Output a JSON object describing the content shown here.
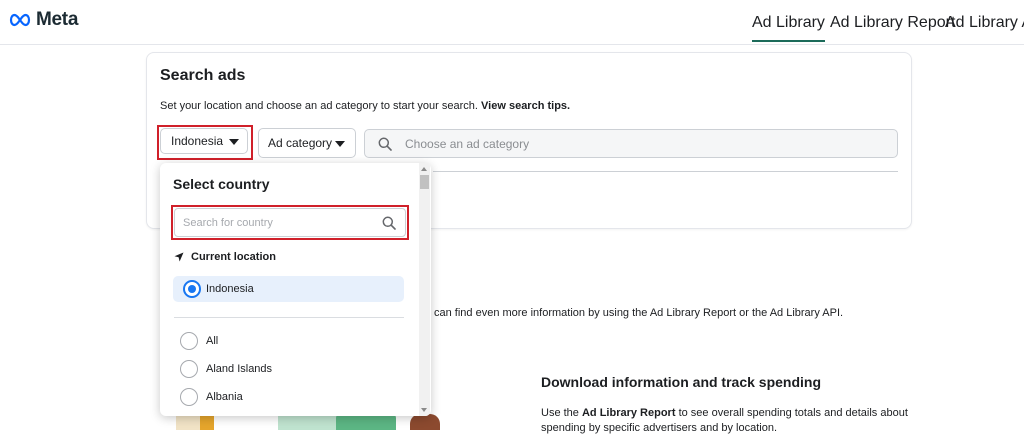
{
  "header": {
    "logo_text": "Meta",
    "nav": [
      "Ad Library",
      "Ad Library Report",
      "Ad Library API"
    ]
  },
  "search": {
    "title": "Search ads",
    "subtitle": "Set your location and choose an ad category to start your search.",
    "tips_link": "View search tips.",
    "country_value": "Indonesia",
    "category_label": "Ad category",
    "placeholder": "Choose an ad category"
  },
  "dropdown": {
    "title": "Select country",
    "search_placeholder": "Search for country",
    "current_location_label": "Current location",
    "selected": "Indonesia",
    "options": [
      "All",
      "Aland Islands",
      "Albania"
    ]
  },
  "body": {
    "info_text": "can find even more information by using the Ad Library Report or the Ad Library API.",
    "download_title": "Download information and track spending",
    "download_text_prefix": "Use the",
    "download_link": "Ad Library Report",
    "download_text_suffix": "to see overall spending totals and details about spending by specific advertisers and by location."
  },
  "colors": {
    "accent": "#1877f2",
    "highlight": "#d0202a",
    "active_underline": "#1c6b5a"
  }
}
